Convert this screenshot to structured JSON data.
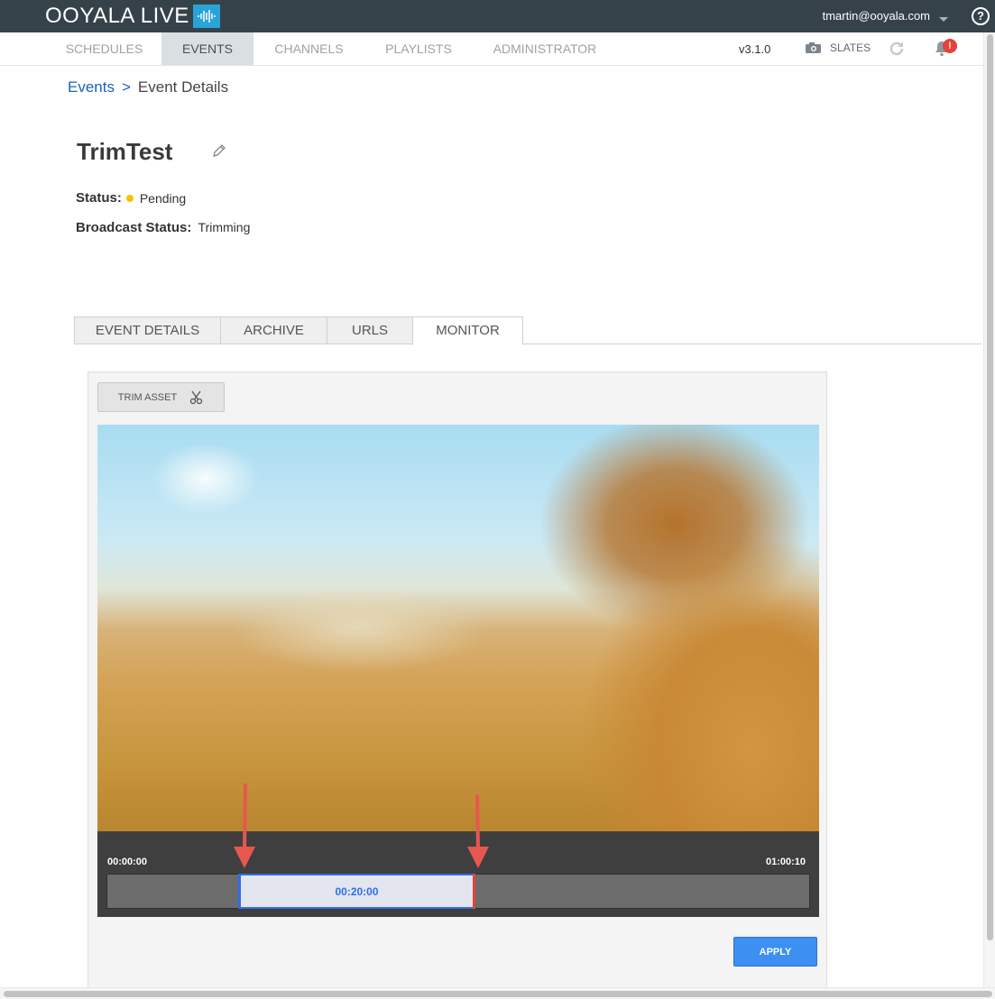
{
  "header": {
    "brand": "OOYALA LIVE",
    "user_email": "tmartin@ooyala.com",
    "help_label": "?"
  },
  "nav": {
    "items": [
      {
        "label": "SCHEDULES",
        "active": false
      },
      {
        "label": "EVENTS",
        "active": true
      },
      {
        "label": "CHANNELS",
        "active": false
      },
      {
        "label": "PLAYLISTS",
        "active": false
      },
      {
        "label": "ADMINISTRATOR",
        "active": false
      }
    ],
    "version": "v3.1.0",
    "slates_label": "SLATES",
    "notification_badge": "!"
  },
  "breadcrumb": {
    "parent": "Events",
    "separator": ">",
    "current": "Event Details"
  },
  "event": {
    "title": "TrimTest",
    "status_label": "Status:",
    "status_value": "Pending",
    "broadcast_status_label": "Broadcast Status:",
    "broadcast_status_value": "Trimming"
  },
  "tabs": [
    {
      "label": "EVENT DETAILS",
      "active": false
    },
    {
      "label": "ARCHIVE",
      "active": false
    },
    {
      "label": "URLS",
      "active": false
    },
    {
      "label": "MONITOR",
      "active": true
    }
  ],
  "monitor": {
    "trim_button_label": "TRIM ASSET",
    "timeline_start": "00:00:00",
    "timeline_end": "01:00:10",
    "selection_duration": "00:20:00",
    "apply_label": "APPLY"
  },
  "colors": {
    "topbar": "#36424a",
    "accent_blue": "#3d8ff2",
    "selection_border": "#2f6cf0",
    "status_pending": "#f4c400",
    "arrow_red": "#e8574f",
    "notification_red": "#e8413a"
  }
}
